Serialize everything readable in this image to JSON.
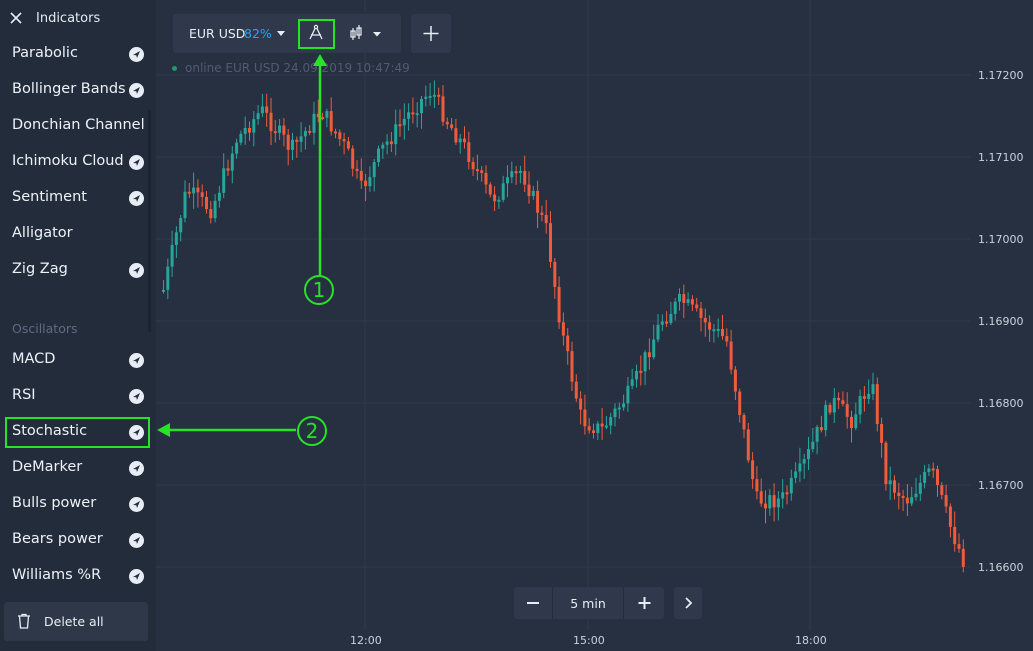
{
  "sidebar": {
    "title": "Indicators",
    "trend_items": [
      {
        "label": "Parabolic",
        "has_arrow": true
      },
      {
        "label": "Bollinger Bands",
        "has_arrow": true
      },
      {
        "label": "Donchian Channel",
        "has_arrow": false
      },
      {
        "label": "Ichimoku Cloud",
        "has_arrow": true
      },
      {
        "label": "Sentiment",
        "has_arrow": true
      },
      {
        "label": "Alligator",
        "has_arrow": false
      },
      {
        "label": "Zig Zag",
        "has_arrow": true
      }
    ],
    "oscillators_heading": "Oscillators",
    "oscillator_items": [
      {
        "label": "MACD",
        "has_arrow": true
      },
      {
        "label": "RSI",
        "has_arrow": true
      },
      {
        "label": "Stochastic",
        "has_arrow": true
      },
      {
        "label": "DeMarker",
        "has_arrow": true
      },
      {
        "label": "Bulls power",
        "has_arrow": true
      },
      {
        "label": "Bears power",
        "has_arrow": true
      },
      {
        "label": "Williams %R",
        "has_arrow": true
      }
    ],
    "delete_all_label": "Delete all"
  },
  "toolbar": {
    "pair": "EUR USD",
    "payout": "82%",
    "plus_icon": "plus-icon",
    "drawing_tool_icon": "compass-drawing-icon",
    "chart_type_icon": "candlestick-icon"
  },
  "status": {
    "text": "online EUR USD  24.09.2019 10:47:49"
  },
  "price_axis": [
    "1.17200",
    "1.17100",
    "1.17000",
    "1.16900",
    "1.16800",
    "1.16700",
    "1.16600"
  ],
  "time_axis": [
    "12:00",
    "15:00",
    "18:00"
  ],
  "zoom": {
    "timeframe": "5 min"
  },
  "callouts": {
    "one": "1",
    "two": "2"
  },
  "colors": {
    "up": "#26a69a",
    "down": "#ef5b3c",
    "highlight": "#27e227",
    "accent": "#2aa3ef"
  }
}
